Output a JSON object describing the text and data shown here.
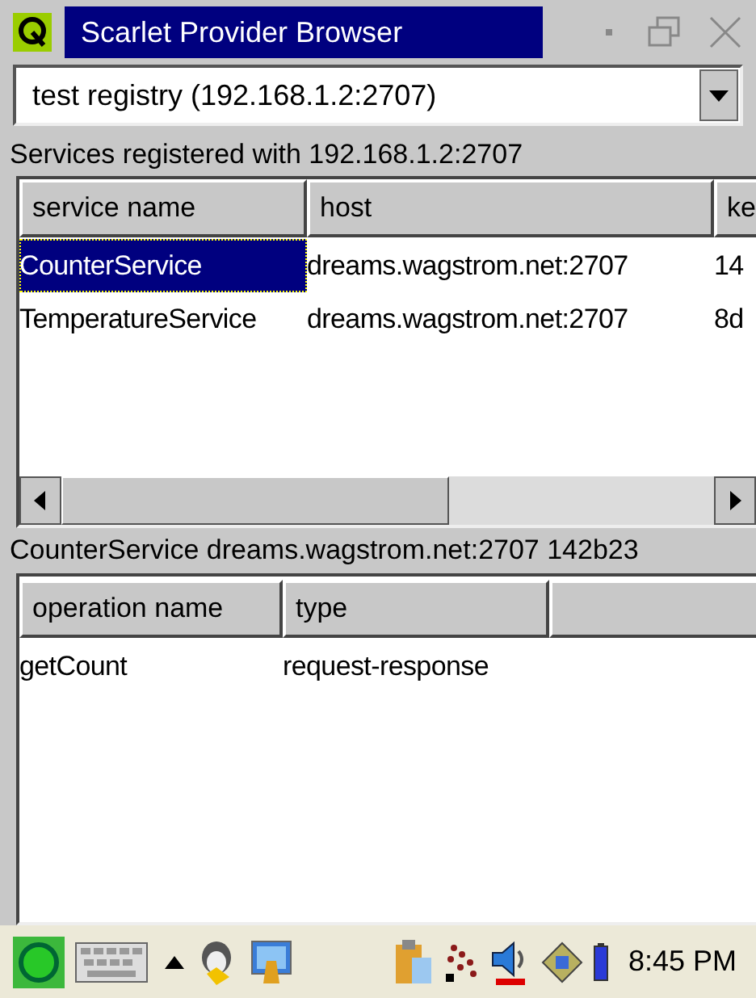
{
  "window": {
    "title": "Scarlet Provider Browser"
  },
  "registry_select": {
    "value": "test registry (192.168.1.2:2707)"
  },
  "services_label": "Services registered with 192.168.1.2:2707",
  "services_table": {
    "columns": [
      "service name",
      "host",
      "ke"
    ],
    "rows": [
      {
        "cells": [
          "CounterService",
          "dreams.wagstrom.net:2707",
          "14"
        ],
        "selected": true
      },
      {
        "cells": [
          "TemperatureService",
          "dreams.wagstrom.net:2707",
          "8d"
        ],
        "selected": false
      }
    ]
  },
  "detail_label": "CounterService dreams.wagstrom.net:2707  142b23",
  "operations_table": {
    "columns": [
      "operation name",
      "type"
    ],
    "rows": [
      {
        "cells": [
          "getCount",
          "request-response"
        ],
        "selected": false
      }
    ]
  },
  "taskbar": {
    "clock": "8:45 PM"
  }
}
